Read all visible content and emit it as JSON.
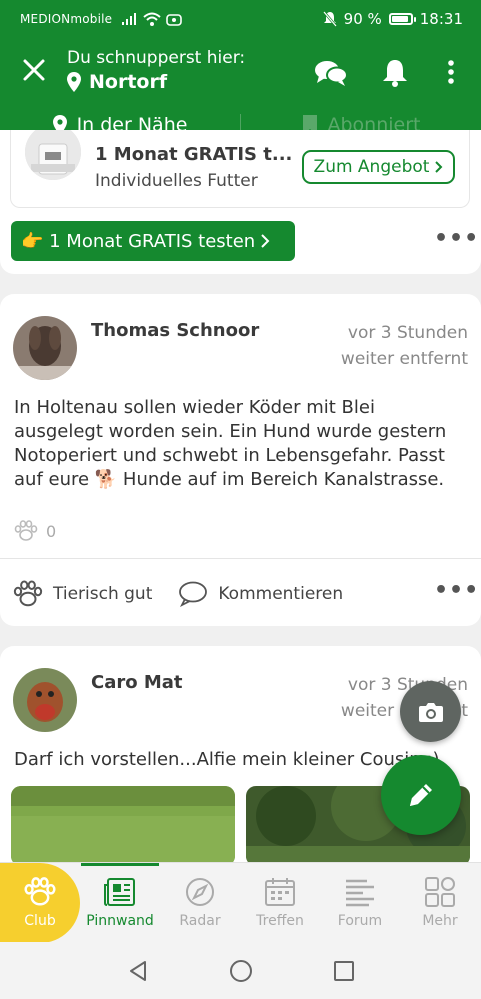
{
  "status_bar": {
    "carrier": "MEDIONmobile",
    "battery": "90 %",
    "battery_level": 0.9,
    "time": "18:31"
  },
  "header": {
    "location_prefix": "Du schnupperst hier:",
    "location_name": "Nortorf",
    "tabs": [
      {
        "label": "In der Nähe",
        "active": true
      },
      {
        "label": "Abonniert",
        "active": false
      }
    ]
  },
  "ad": {
    "title": "1 Monat GRATIS t...",
    "subtitle": "Individuelles Futter",
    "button": "Zum Angebot",
    "cta": "👉 1 Monat GRATIS testen"
  },
  "posts": [
    {
      "author": "Thomas Schnoor",
      "time": "vor 3 Stunden",
      "distance": "weiter entfernt",
      "text": "In Holtenau  sollen wieder Köder mit Blei ausgelegt worden sein. Ein Hund wurde gestern Notoperiert und schwebt in Lebensgefahr. Passt auf eure 🐕 Hunde auf im Bereich Kanalstrasse.",
      "likes": "0",
      "like_label": "Tierisch gut",
      "comment_label": "Kommentieren"
    },
    {
      "author": "Caro Mat",
      "time": "vor 3 Stunden",
      "distance": "weiter entfernt",
      "text": "Darf ich vorstellen...Alfie mein kleiner Cousin :)"
    }
  ],
  "bottom_nav": [
    {
      "label": "Club",
      "icon": "paw-icon"
    },
    {
      "label": "Pinnwand",
      "icon": "newspaper-icon",
      "active": true
    },
    {
      "label": "Radar",
      "icon": "compass-icon"
    },
    {
      "label": "Treffen",
      "icon": "calendar-icon"
    },
    {
      "label": "Forum",
      "icon": "forum-icon"
    },
    {
      "label": "Mehr",
      "icon": "grid-icon"
    }
  ],
  "colors": {
    "brand_green": "#15892f",
    "club_yellow": "#f6cf2e"
  }
}
